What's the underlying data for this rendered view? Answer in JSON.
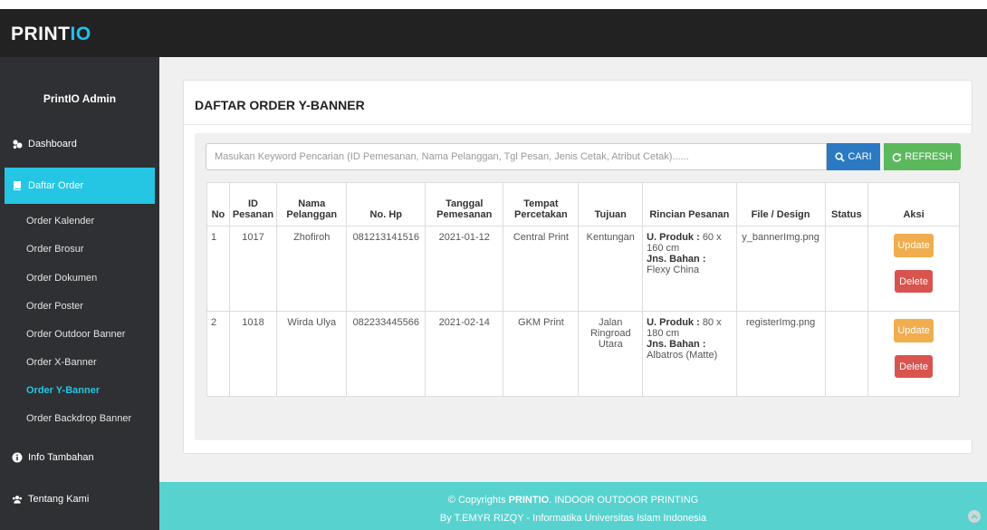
{
  "navbar": {
    "brand_a": "PRINT",
    "brand_b": "IO"
  },
  "sidebar": {
    "admin": "PrintIO Admin",
    "dashboard": "Dashboard",
    "daftar_order": "Daftar Order",
    "sub_items": [
      "Order Kalender",
      "Order Brosur",
      "Order Dokumen",
      "Order Poster",
      "Order Outdoor Banner",
      "Order X-Banner",
      "Order Y-Banner",
      "Order Backdrop Banner"
    ],
    "active_sub": "Order Y-Banner",
    "info": "Info Tambahan",
    "tentang": "Tentang Kami"
  },
  "panel": {
    "title": "DAFTAR ORDER Y-BANNER",
    "search_placeholder": "Masukan Keyword Pencarian (ID Pemesanan, Nama Pelanggan, Tgl Pesan, Jenis Cetak, Atribut Cetak)......",
    "cari": "CARI",
    "refresh": "REFRESH"
  },
  "table": {
    "headers": [
      "No",
      "ID Pesanan",
      "Nama Pelanggan",
      "No. Hp",
      "Tanggal Pemesanan",
      "Tempat Percetakan",
      "Tujuan",
      "Rincian Pesanan",
      "File / Design",
      "Status",
      "Aksi"
    ],
    "rows": [
      {
        "no": "1",
        "id": "1017",
        "nama": "Zhofiroh",
        "hp": "081213141516",
        "tanggal": "2021-01-12",
        "tempat": "Central Print",
        "tujuan": "Kentungan",
        "produk_label": "U. Produk :",
        "produk": "60 x 160 cm",
        "bahan_label": "Jns. Bahan :",
        "bahan": "Flexy China",
        "file": "y_bannerImg.png",
        "status": "",
        "update": "Update",
        "delete": "Delete"
      },
      {
        "no": "2",
        "id": "1018",
        "nama": "Wirda Ulya",
        "hp": "082233445566",
        "tanggal": "2021-02-14",
        "tempat": "GKM Print",
        "tujuan": "Jalan Ringroad Utara",
        "produk_label": "U. Produk :",
        "produk": "80 x 180 cm",
        "bahan_label": "Jns. Bahan :",
        "bahan": "Albatros (Matte)",
        "file": "registerImg.png",
        "status": "",
        "update": "Update",
        "delete": "Delete"
      }
    ]
  },
  "footer": {
    "copy_prefix": "© Copyrights ",
    "brand": "PRINTIO",
    "copy_suffix": ". INDOOR OUTDOOR PRINTING",
    "line2": "By T.EMYR RIZQY - Informatika Universitas Islam Indonesia"
  },
  "colors": {
    "navbar": "#222222",
    "sidebar": "#2f3033",
    "accent": "#24c6e4",
    "cari": "#2a79c2",
    "refresh": "#5cb85c",
    "update": "#f0ad4e",
    "delete": "#d9534f",
    "footer": "#57d2cf"
  }
}
